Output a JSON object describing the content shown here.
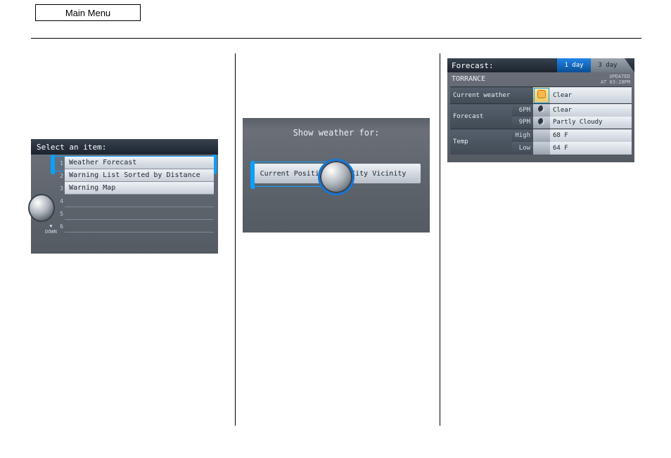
{
  "main_menu_label": "Main Menu",
  "screen1": {
    "header": "Select an item:",
    "items": [
      "Weather Forecast",
      "Warning List Sorted by Distance",
      "Warning Map"
    ],
    "down_label": "▼\nDOWN"
  },
  "screen2": {
    "title": "Show weather for:",
    "option_left": "Current Position",
    "option_right": "City Vicinity"
  },
  "screen3": {
    "topbar_label": "Forecast:",
    "tab_active": "1 day",
    "tab_inactive": "3 day",
    "city": "TORRANCE",
    "updated_line1": "UPDATED",
    "updated_line2": "AT 03:28PM",
    "row_current_label": "Current weather",
    "row_current_value": "Clear",
    "row_forecast_label": "Forecast",
    "forecast_6pm_sub": "6PM",
    "forecast_6pm_value": "Clear",
    "forecast_9pm_sub": "9PM",
    "forecast_9pm_value": "Partly Cloudy",
    "row_temp_label": "Temp",
    "temp_high_sub": "High",
    "temp_high_value": "68 F",
    "temp_low_sub": "Low",
    "temp_low_value": "64 F"
  }
}
